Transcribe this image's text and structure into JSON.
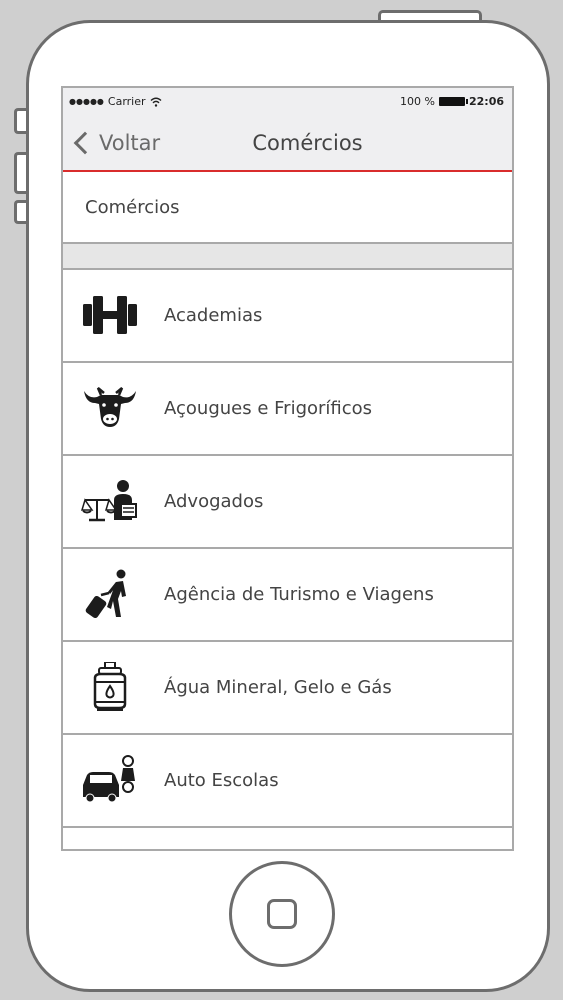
{
  "status": {
    "carrier": "Carrier",
    "battery": "100 %",
    "time": "22:06"
  },
  "nav": {
    "back_label": "Voltar",
    "title": "Comércios"
  },
  "section": {
    "label": "Comércios"
  },
  "items": [
    {
      "label": "Academias",
      "icon": "dumbbell-icon"
    },
    {
      "label": "Açougues e Frigoríficos",
      "icon": "cow-icon"
    },
    {
      "label": "Advogados",
      "icon": "lawyer-icon"
    },
    {
      "label": "Agência de Turismo e Viagens",
      "icon": "traveler-icon"
    },
    {
      "label": "Água Mineral, Gelo e Gás",
      "icon": "gas-cylinder-icon"
    },
    {
      "label": "Auto Escolas",
      "icon": "driving-school-icon"
    }
  ],
  "colors": {
    "accent": "#d92c2c",
    "frame": "#6d6d6d",
    "bar": "#efeff1"
  }
}
